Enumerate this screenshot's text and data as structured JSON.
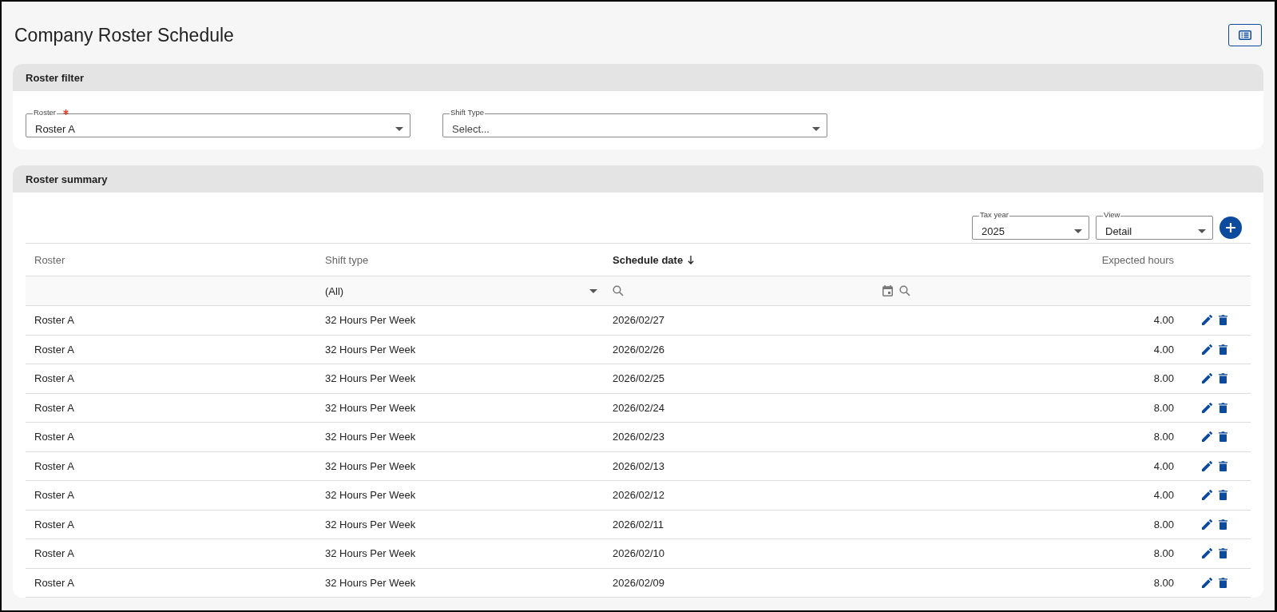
{
  "page": {
    "title": "Company Roster Schedule"
  },
  "filter_panel": {
    "title": "Roster filter",
    "fields": [
      {
        "label": "Roster",
        "required": true,
        "value": "Roster A"
      },
      {
        "label": "Shift Type",
        "required": false,
        "placeholder": "Select..."
      }
    ]
  },
  "summary_panel": {
    "title": "Roster summary",
    "controls": [
      {
        "label": "Tax year",
        "value": "2025"
      },
      {
        "label": "View",
        "value": "Detail"
      }
    ],
    "table": {
      "columns": [
        {
          "label": "Roster",
          "sorted": false
        },
        {
          "label": "Shift type",
          "sorted": false
        },
        {
          "label": "Schedule date",
          "sorted": true
        },
        {
          "label": "Expected hours",
          "sorted": false
        }
      ],
      "filter_row": {
        "shift_type": "(All)"
      },
      "rows": [
        [
          "Roster A",
          "32 Hours Per Week",
          "2026/02/27",
          "4.00"
        ],
        [
          "Roster A",
          "32 Hours Per Week",
          "2026/02/26",
          "4.00"
        ],
        [
          "Roster A",
          "32 Hours Per Week",
          "2026/02/25",
          "8.00"
        ],
        [
          "Roster A",
          "32 Hours Per Week",
          "2026/02/24",
          "8.00"
        ],
        [
          "Roster A",
          "32 Hours Per Week",
          "2026/02/23",
          "8.00"
        ],
        [
          "Roster A",
          "32 Hours Per Week",
          "2026/02/13",
          "4.00"
        ],
        [
          "Roster A",
          "32 Hours Per Week",
          "2026/02/12",
          "4.00"
        ],
        [
          "Roster A",
          "32 Hours Per Week",
          "2026/02/11",
          "8.00"
        ],
        [
          "Roster A",
          "32 Hours Per Week",
          "2026/02/10",
          "8.00"
        ],
        [
          "Roster A",
          "32 Hours Per Week",
          "2026/02/09",
          "8.00"
        ]
      ]
    }
  }
}
